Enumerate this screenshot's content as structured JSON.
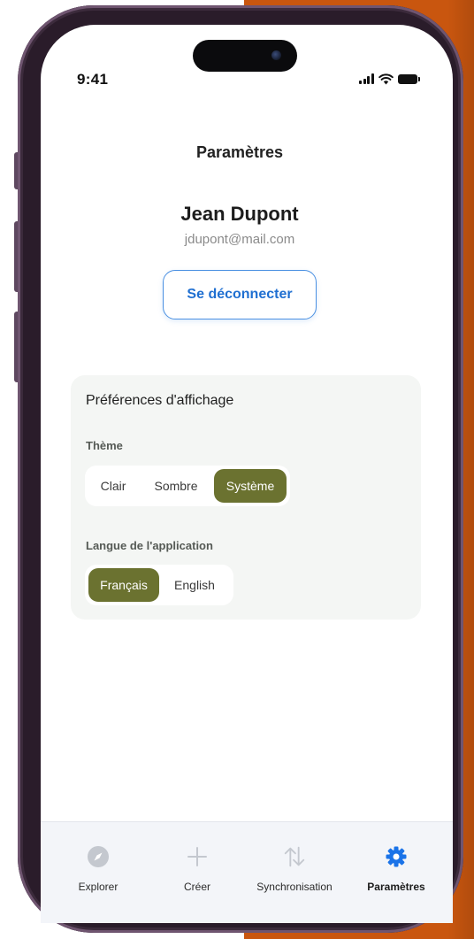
{
  "status_bar": {
    "time": "9:41",
    "signal_icon": "cellular-signal-icon",
    "wifi_icon": "wifi-icon",
    "battery_icon": "battery-icon"
  },
  "header": {
    "title": "Paramètres"
  },
  "profile": {
    "name": "Jean Dupont",
    "email": "jdupont@mail.com",
    "logout_label": "Se déconnecter"
  },
  "preferences": {
    "title": "Préférences d'affichage",
    "theme": {
      "label": "Thème",
      "options": [
        "Clair",
        "Sombre",
        "Système"
      ],
      "selected": "Système"
    },
    "language": {
      "label": "Langue de l'application",
      "options": [
        "Français",
        "English"
      ],
      "selected": "Français"
    }
  },
  "tabbar": {
    "items": [
      {
        "label": "Explorer",
        "icon": "compass-icon",
        "active": false
      },
      {
        "label": "Créer",
        "icon": "plus-icon",
        "active": false
      },
      {
        "label": "Synchronisation",
        "icon": "sync-arrows-icon",
        "active": false
      },
      {
        "label": "Paramètres",
        "icon": "gear-icon",
        "active": true
      }
    ]
  },
  "colors": {
    "accent_blue": "#1f6fd1",
    "selected_green": "#6b7230",
    "device_frame": "#2a1c2a",
    "background_orange": "#c9560f",
    "active_tab_icon": "#1a73e8",
    "inactive_tab_icon": "#c4c8cf"
  }
}
